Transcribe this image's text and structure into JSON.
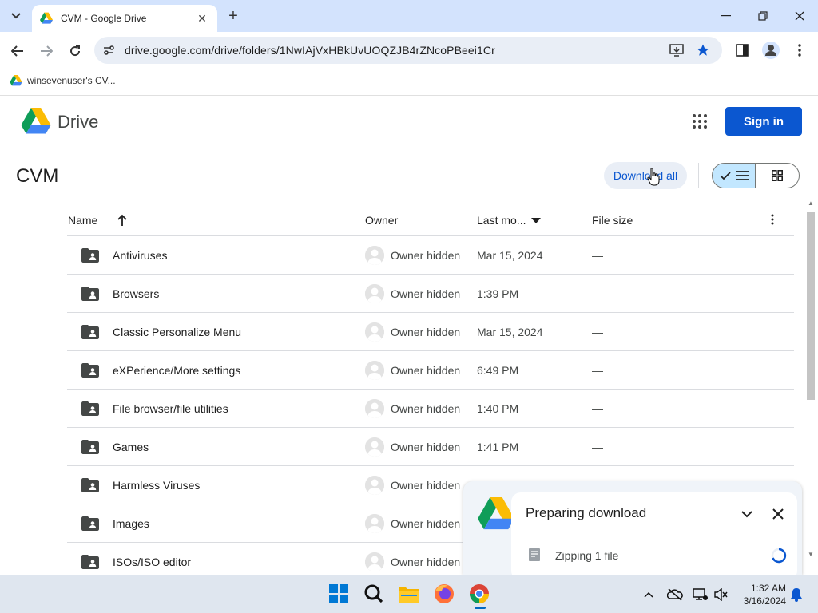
{
  "browser": {
    "tab_title": "CVM - Google Drive",
    "url": "drive.google.com/drive/folders/1NwIAjVxHBkUvUOQZJB4rZNcoPBeei1Cr",
    "bookmark_label": "winsevenuser's CV..."
  },
  "drive": {
    "brand": "Drive",
    "sign_in_label": "Sign in",
    "folder_title": "CVM",
    "download_all_label": "Download all",
    "columns": {
      "name": "Name",
      "owner": "Owner",
      "modified": "Last mo...",
      "size": "File size"
    },
    "rows": [
      {
        "name": "Antiviruses",
        "owner": "Owner hidden",
        "modified": "Mar 15, 2024",
        "size": "—"
      },
      {
        "name": "Browsers",
        "owner": "Owner hidden",
        "modified": "1:39 PM",
        "size": "—"
      },
      {
        "name": "Classic Personalize Menu",
        "owner": "Owner hidden",
        "modified": "Mar 15, 2024",
        "size": "—"
      },
      {
        "name": "eXPerience/More settings",
        "owner": "Owner hidden",
        "modified": "6:49 PM",
        "size": "—"
      },
      {
        "name": "File browser/file utilities",
        "owner": "Owner hidden",
        "modified": "1:40 PM",
        "size": "—"
      },
      {
        "name": "Games",
        "owner": "Owner hidden",
        "modified": "1:41 PM",
        "size": "—"
      },
      {
        "name": "Harmless Viruses",
        "owner": "Owner hidden",
        "modified": "",
        "size": ""
      },
      {
        "name": "Images",
        "owner": "Owner hidden",
        "modified": "",
        "size": ""
      },
      {
        "name": "ISOs/ISO editor",
        "owner": "Owner hidden",
        "modified": "",
        "size": ""
      }
    ]
  },
  "download_panel": {
    "title": "Preparing download",
    "status": "Zipping 1 file"
  },
  "taskbar": {
    "time": "1:32 AM",
    "date": "3/16/2024"
  },
  "colors": {
    "tabstrip": "#d3e3fd",
    "accent_blue": "#0b57d0",
    "toggle_selected": "#c2e7ff"
  },
  "icons": [
    "search-tabs-icon",
    "drive-favicon",
    "close-icon",
    "plus-icon",
    "minimize-icon",
    "restore-icon",
    "back-icon",
    "forward-icon",
    "reload-icon",
    "site-info-icon",
    "install-app-icon",
    "star-icon",
    "side-panel-icon",
    "profile-icon",
    "more-vert-icon",
    "google-apps-icon",
    "check-icon",
    "list-icon",
    "grid-icon",
    "sort-arrow-up-icon",
    "sort-caret-down-icon",
    "shared-folder-icon",
    "avatar-icon",
    "chevron-down-icon",
    "spinner-icon",
    "windows-start-icon",
    "search-icon",
    "file-explorer-icon",
    "firefox-icon",
    "chrome-icon",
    "bell-icon"
  ]
}
